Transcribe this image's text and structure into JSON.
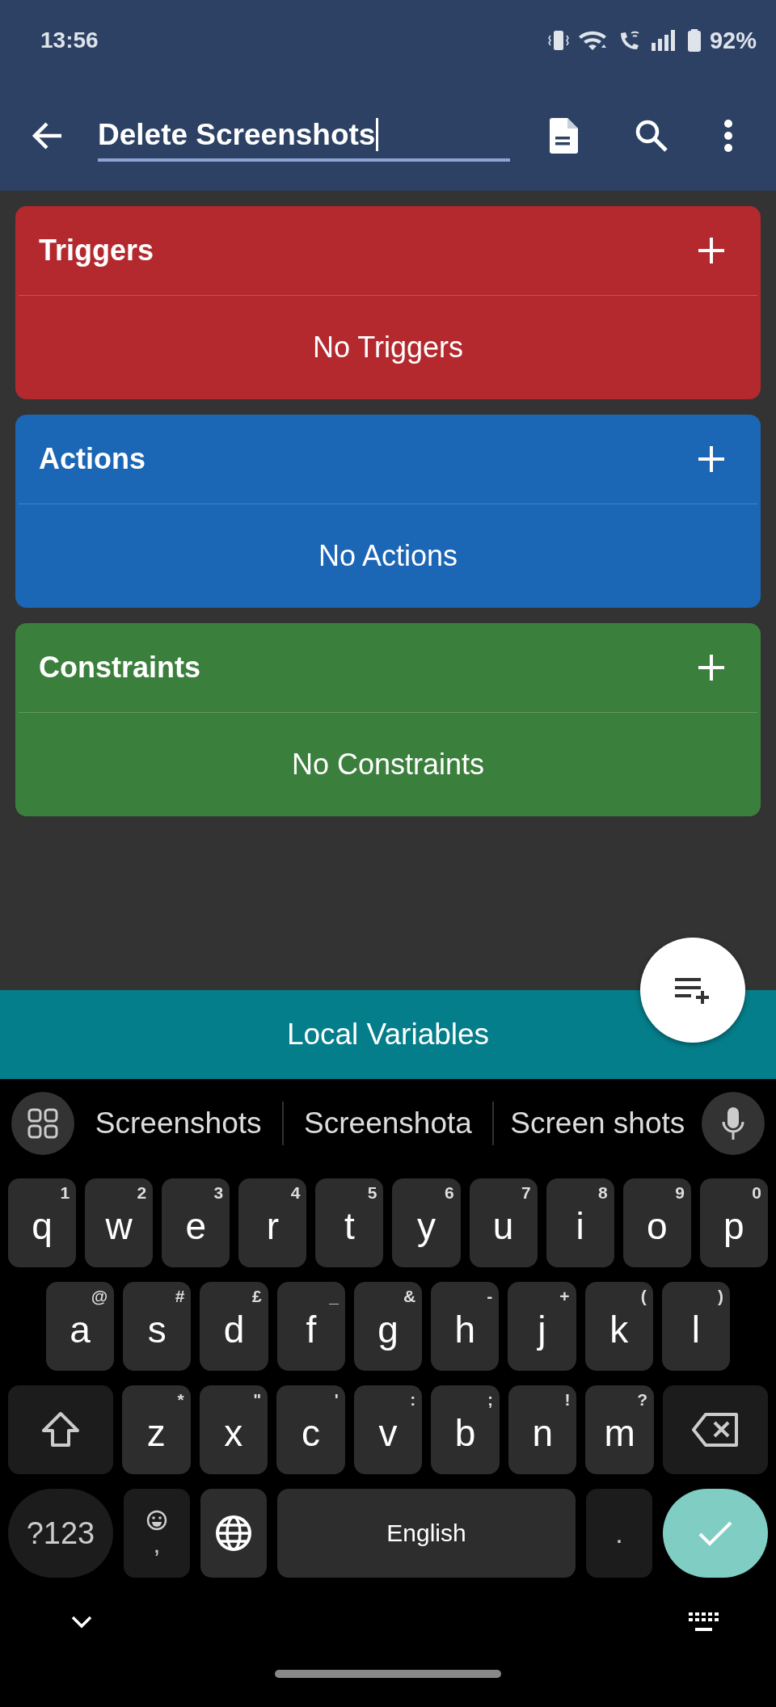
{
  "status_bar": {
    "time": "13:56",
    "battery": "92%"
  },
  "app_bar": {
    "title_value": "Delete Screenshots"
  },
  "sections": [
    {
      "title": "Triggers",
      "empty_text": "No Triggers",
      "color": "#b3292e"
    },
    {
      "title": "Actions",
      "empty_text": "No Actions",
      "color": "#1b66b5"
    },
    {
      "title": "Constraints",
      "empty_text": "No Constraints",
      "color": "#3b7f3d"
    }
  ],
  "local_variables_bar": {
    "label": "Local Variables"
  },
  "keyboard": {
    "suggestions": [
      "Screenshots",
      "Screenshota",
      "Screen shots"
    ],
    "rows": [
      {
        "keys": [
          {
            "kind": "letter",
            "label": "q",
            "hint": "1"
          },
          {
            "kind": "letter",
            "label": "w",
            "hint": "2"
          },
          {
            "kind": "letter",
            "label": "e",
            "hint": "3"
          },
          {
            "kind": "letter",
            "label": "r",
            "hint": "4"
          },
          {
            "kind": "letter",
            "label": "t",
            "hint": "5"
          },
          {
            "kind": "letter",
            "label": "y",
            "hint": "6"
          },
          {
            "kind": "letter",
            "label": "u",
            "hint": "7"
          },
          {
            "kind": "letter",
            "label": "i",
            "hint": "8"
          },
          {
            "kind": "letter",
            "label": "o",
            "hint": "9"
          },
          {
            "kind": "letter",
            "label": "p",
            "hint": "0"
          }
        ]
      },
      {
        "keys": [
          {
            "kind": "letter",
            "label": "a",
            "hint": "@"
          },
          {
            "kind": "letter",
            "label": "s",
            "hint": "#"
          },
          {
            "kind": "letter",
            "label": "d",
            "hint": "£"
          },
          {
            "kind": "letter",
            "label": "f",
            "hint": "_"
          },
          {
            "kind": "letter",
            "label": "g",
            "hint": "&"
          },
          {
            "kind": "letter",
            "label": "h",
            "hint": "-"
          },
          {
            "kind": "letter",
            "label": "j",
            "hint": "+"
          },
          {
            "kind": "letter",
            "label": "k",
            "hint": "("
          },
          {
            "kind": "letter",
            "label": "l",
            "hint": ")"
          }
        ]
      },
      {
        "keys": [
          {
            "kind": "shift"
          },
          {
            "kind": "letter",
            "label": "z",
            "hint": "*"
          },
          {
            "kind": "letter",
            "label": "x",
            "hint": "\""
          },
          {
            "kind": "letter",
            "label": "c",
            "hint": "'"
          },
          {
            "kind": "letter",
            "label": "v",
            "hint": ":"
          },
          {
            "kind": "letter",
            "label": "b",
            "hint": ";"
          },
          {
            "kind": "letter",
            "label": "n",
            "hint": "!"
          },
          {
            "kind": "letter",
            "label": "m",
            "hint": "?"
          },
          {
            "kind": "backspace"
          }
        ]
      },
      {
        "keys": [
          {
            "kind": "symbols",
            "label": "?123"
          },
          {
            "kind": "comma",
            "label": ","
          },
          {
            "kind": "globe"
          },
          {
            "kind": "space",
            "label": "English"
          },
          {
            "kind": "period",
            "label": "."
          },
          {
            "kind": "enter"
          }
        ]
      }
    ]
  }
}
